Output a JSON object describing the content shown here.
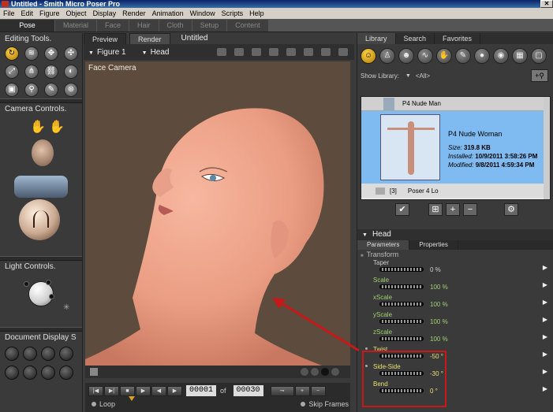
{
  "window": {
    "title": "Untitled - Smith Micro Poser Pro"
  },
  "menu": [
    "File",
    "Edit",
    "Figure",
    "Object",
    "Display",
    "Render",
    "Animation",
    "Window",
    "Scripts",
    "Help"
  ],
  "rooms": [
    "Pose",
    "Material",
    "Face",
    "Hair",
    "Cloth",
    "Setup",
    "Content"
  ],
  "left": {
    "editing_tools_label": "Editing Tools.",
    "camera_controls_label": "Camera Controls.",
    "light_controls_label": "Light Controls.",
    "document_display_label": "Document Display S"
  },
  "viewport": {
    "tabs": [
      "Preview",
      "Render"
    ],
    "doc_title": "Untitled",
    "figure_select": "Figure 1",
    "actor_select": "Head",
    "camera_label": "Face Camera"
  },
  "animation": {
    "current_frame": "00001",
    "of_label": "of",
    "total_frames": "00030",
    "loop_label": "Loop",
    "skip_frames_label": "Skip Frames"
  },
  "library": {
    "tabs": [
      "Library",
      "Search",
      "Favorites"
    ],
    "show_library_label": "Show Library:",
    "show_library_value": "<All>",
    "items": {
      "row1_name": "P4 Nude Man",
      "selected_name": "P4 Nude Woman",
      "size_label": "Size:",
      "size_value": "319.8 KB",
      "installed_label": "Installed:",
      "installed_value": "10/9/2011 3:58:26 PM",
      "modified_label": "Modified:",
      "modified_value": "9/8/2011 4:59:34 PM",
      "folder_count": "[3]",
      "folder_name": "Poser 4 Lo"
    }
  },
  "params": {
    "header": "Head",
    "tabs": [
      "Parameters",
      "Properties"
    ],
    "group": "Transform",
    "rows": [
      {
        "name": "Taper",
        "value": "0 %"
      },
      {
        "name": "Scale",
        "value": "100 %"
      },
      {
        "name": "xScale",
        "value": "100 %"
      },
      {
        "name": "yScale",
        "value": "100 %"
      },
      {
        "name": "zScale",
        "value": "100 %"
      },
      {
        "name": "Twist",
        "value": "-50 °"
      },
      {
        "name": "Side-Side",
        "value": "-30 °"
      },
      {
        "name": "Bend",
        "value": "0 °"
      }
    ]
  },
  "colors": {
    "accent": "#ffd24a",
    "annotation": "#c81818",
    "param_value": "#9fd070",
    "selection": "#7fbaf0"
  }
}
